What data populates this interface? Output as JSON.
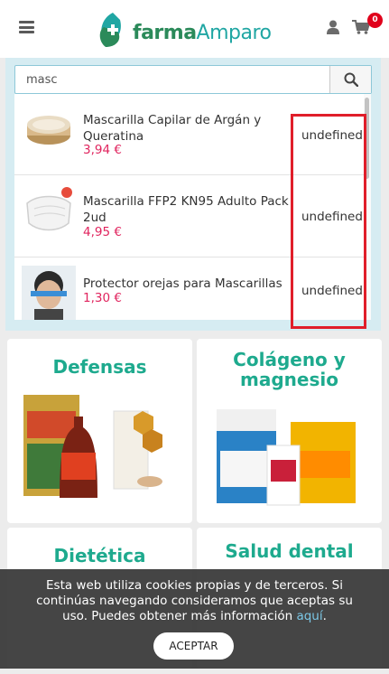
{
  "header": {
    "menu_icon": "hamburger-icon",
    "logo_text_bold": "farma",
    "logo_text_light": "Amparo",
    "user_icon": "user-icon",
    "cart_icon": "cart-icon",
    "cart_count": "0"
  },
  "search": {
    "value": "masc",
    "button_icon": "search-icon"
  },
  "results": [
    {
      "name": "Mascarilla Capilar de Argán y Queratina",
      "price": "3,94 €",
      "extra": "undefined"
    },
    {
      "name": "Mascarilla FFP2 KN95 Adulto Pack 2ud",
      "price": "4,95 €",
      "extra": "undefined"
    },
    {
      "name": "Protector orejas para Mascarillas",
      "price": "1,30 €",
      "extra": "undefined"
    }
  ],
  "categories": [
    {
      "title": "Defensas"
    },
    {
      "title": "Colágeno y magnesio"
    },
    {
      "title": "Dietética"
    },
    {
      "title": "Salud dental"
    }
  ],
  "cookie": {
    "text": "Esta web utiliza cookies propias y de terceros. Si continúas navegando consideramos que aceptas su uso. Puedes obtener más información",
    "link": "aquí",
    "text_end": ".",
    "button": "ACEPTAR"
  },
  "colors": {
    "brand_green": "#2b8a5a",
    "brand_teal": "#20a6a3",
    "price_pink": "#e0245e",
    "category_title": "#1eaa8e",
    "badge_red": "#e0001b",
    "highlight_red": "#e01e2a"
  }
}
